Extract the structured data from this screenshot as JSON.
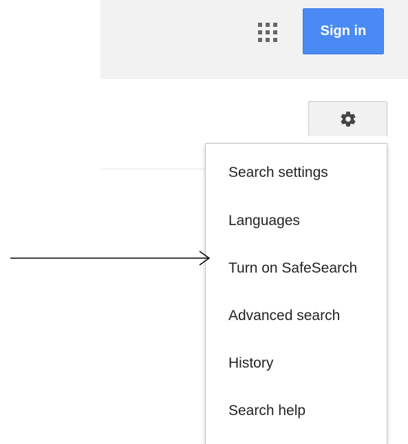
{
  "header": {
    "apps_icon": "apps-grid-icon",
    "signin_label": "Sign in",
    "signin_color": "#4a8af4"
  },
  "settings": {
    "gear_icon": "gear-icon"
  },
  "menu": {
    "items": [
      {
        "label": "Search settings"
      },
      {
        "label": "Languages"
      },
      {
        "label": "Turn on SafeSearch"
      },
      {
        "label": "Advanced search"
      },
      {
        "label": "History"
      },
      {
        "label": "Search help"
      }
    ],
    "highlighted_item": "Turn on SafeSearch"
  },
  "annotation": {
    "type": "arrow",
    "points_to": "Turn on SafeSearch"
  }
}
